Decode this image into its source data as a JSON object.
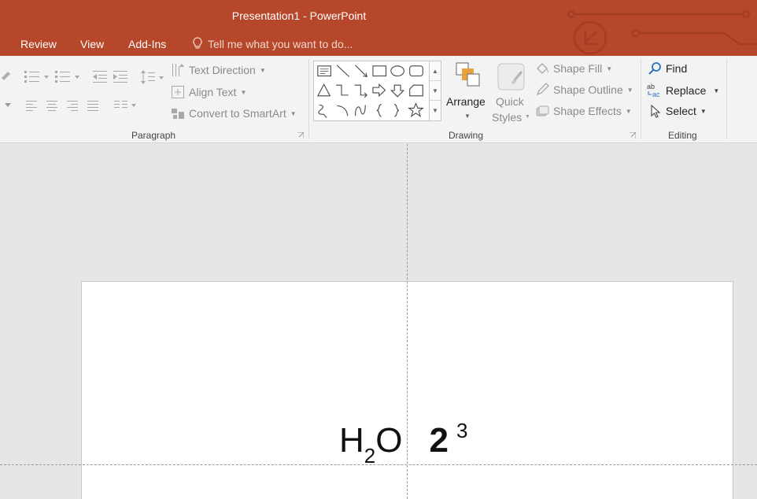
{
  "window": {
    "title": "Presentation1 - PowerPoint"
  },
  "tabs": [
    {
      "label": "Review"
    },
    {
      "label": "View"
    },
    {
      "label": "Add-Ins"
    }
  ],
  "tell_me": {
    "placeholder": "Tell me what you want to do..."
  },
  "ribbon": {
    "paragraph": {
      "label": "Paragraph",
      "text_direction": "Text Direction",
      "align_text": "Align Text",
      "convert_smartart": "Convert to SmartArt"
    },
    "drawing": {
      "label": "Drawing",
      "arrange": "Arrange",
      "quick_styles_1": "Quick",
      "quick_styles_2": "Styles",
      "shape_fill": "Shape Fill",
      "shape_outline": "Shape Outline",
      "shape_effects": "Shape Effects"
    },
    "editing": {
      "label": "Editing",
      "find": "Find",
      "replace": "Replace",
      "select": "Select"
    }
  },
  "slide": {
    "formula_base": "H",
    "formula_sub": "2",
    "formula_end": "O",
    "power_base": "2",
    "power_exp": "3"
  },
  "colors": {
    "accent": "#b7472a",
    "ribbon_bg": "#f3f3f3",
    "canvas_bg": "#e6e6e6"
  }
}
